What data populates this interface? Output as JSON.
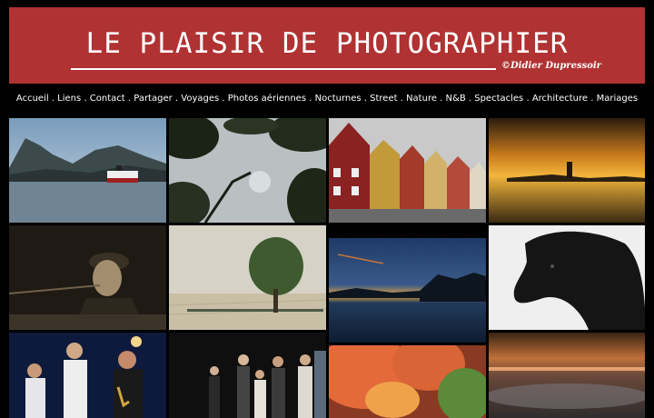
{
  "header": {
    "title": "LE PLAISIR DE PHOTOGRAPHIER",
    "credit": "©Didier Dupressoir"
  },
  "nav": {
    "items": [
      "Accueil",
      "Liens",
      "Contact",
      "Partager",
      "Voyages",
      "Photos aériennes",
      "Nocturnes",
      "Street",
      "Nature",
      "N&B",
      "Spectacles",
      "Architecture",
      "Mariages"
    ],
    "separator": " . "
  },
  "gallery": {
    "photos": [
      {
        "subject": "ship-fjord-mountains"
      },
      {
        "subject": "tree-leaves-silhouette"
      },
      {
        "subject": "bryggen-wooden-houses"
      },
      {
        "subject": "sunset-lighthouse-sea"
      },
      {
        "subject": "musician-singing-sepia"
      },
      {
        "subject": "lone-tree-field"
      },
      {
        "subject": "lake-dusk-reflection"
      },
      {
        "subject": "black-horse-portrait"
      },
      {
        "subject": "jazz-band-stage"
      },
      {
        "subject": "theatre-performers"
      },
      {
        "subject": "autumn-tree-park"
      },
      {
        "subject": "misty-sunset-landscape"
      }
    ]
  }
}
